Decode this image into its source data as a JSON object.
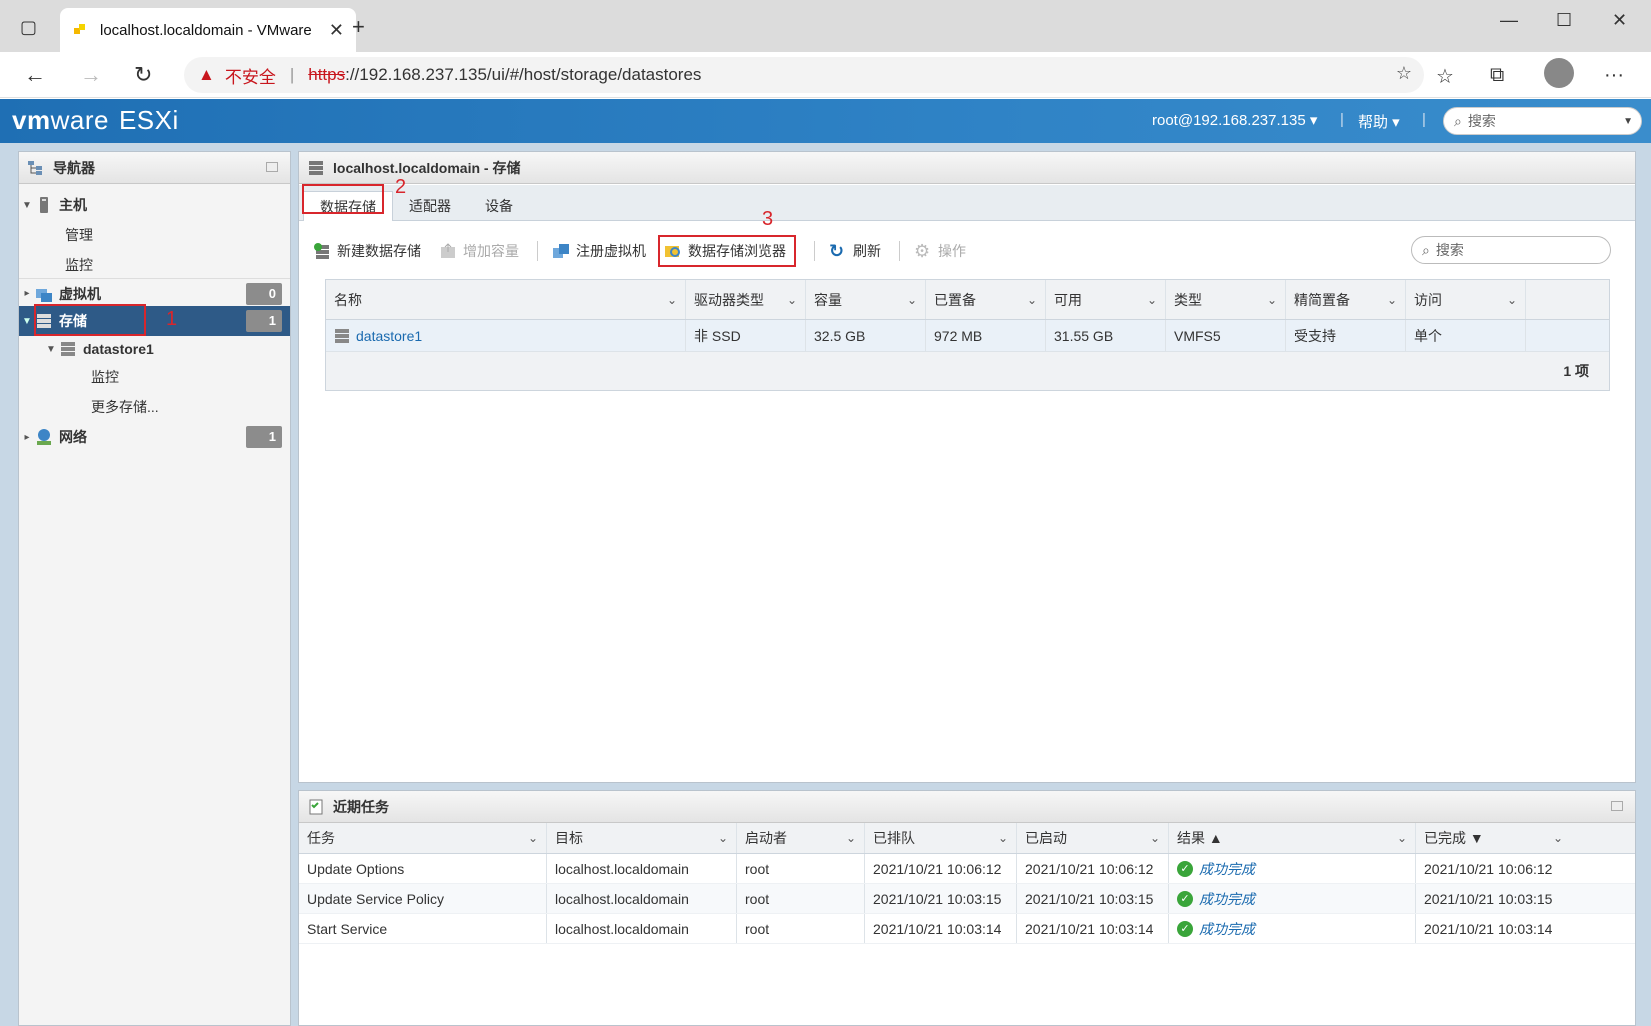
{
  "browser": {
    "tab_title": "localhost.localdomain - VMware",
    "new_tab": "+",
    "security_label": "不安全",
    "url_scheme": "https",
    "url_rest": "://192.168.237.135/ui/#/host/storage/datastores"
  },
  "esxi": {
    "logo_vm": "vm",
    "logo_ware": "ware",
    "logo_product": "ESXi",
    "user": "root@192.168.237.135 ▾",
    "help": "帮助 ▾",
    "search_placeholder": "搜索"
  },
  "navigator": {
    "title": "导航器",
    "host": "主机",
    "manage": "管理",
    "monitor": "监控",
    "vms": "虚拟机",
    "vms_count": "0",
    "storage": "存储",
    "storage_count": "1",
    "datastore": "datastore1",
    "ds_monitor": "监控",
    "more_storage": "更多存储...",
    "network": "网络",
    "network_count": "1"
  },
  "annotations": {
    "n1": "1",
    "n2": "2",
    "n3": "3"
  },
  "main": {
    "title": "localhost.localdomain - 存储",
    "tabs": [
      "数据存储",
      "适配器",
      "设备"
    ],
    "toolbar": {
      "new_ds": "新建数据存储",
      "increase": "增加容量",
      "register_vm": "注册虚拟机",
      "browser": "数据存储浏览器",
      "refresh": "刷新",
      "actions": "操作"
    },
    "search_placeholder": "搜索",
    "columns": [
      "名称",
      "驱动器类型",
      "容量",
      "已置备",
      "可用",
      "类型",
      "精简置备",
      "访问"
    ],
    "rows": [
      [
        "datastore1",
        "非 SSD",
        "32.5 GB",
        "972 MB",
        "31.55 GB",
        "VMFS5",
        "受支持",
        "单个"
      ]
    ],
    "footer": "1 项"
  },
  "tasks": {
    "title": "近期任务",
    "columns": [
      "任务",
      "目标",
      "启动者",
      "已排队",
      "已启动",
      "结果 ▲",
      "已完成 ▼"
    ],
    "rows": [
      [
        "Update Options",
        "localhost.localdomain",
        "root",
        "2021/10/21 10:06:12",
        "2021/10/21 10:06:12",
        "成功完成",
        "2021/10/21 10:06:12"
      ],
      [
        "Update Service Policy",
        "localhost.localdomain",
        "root",
        "2021/10/21 10:03:15",
        "2021/10/21 10:03:15",
        "成功完成",
        "2021/10/21 10:03:15"
      ],
      [
        "Start Service",
        "localhost.localdomain",
        "root",
        "2021/10/21 10:03:14",
        "2021/10/21 10:03:14",
        "成功完成",
        "2021/10/21 10:03:14"
      ]
    ]
  }
}
